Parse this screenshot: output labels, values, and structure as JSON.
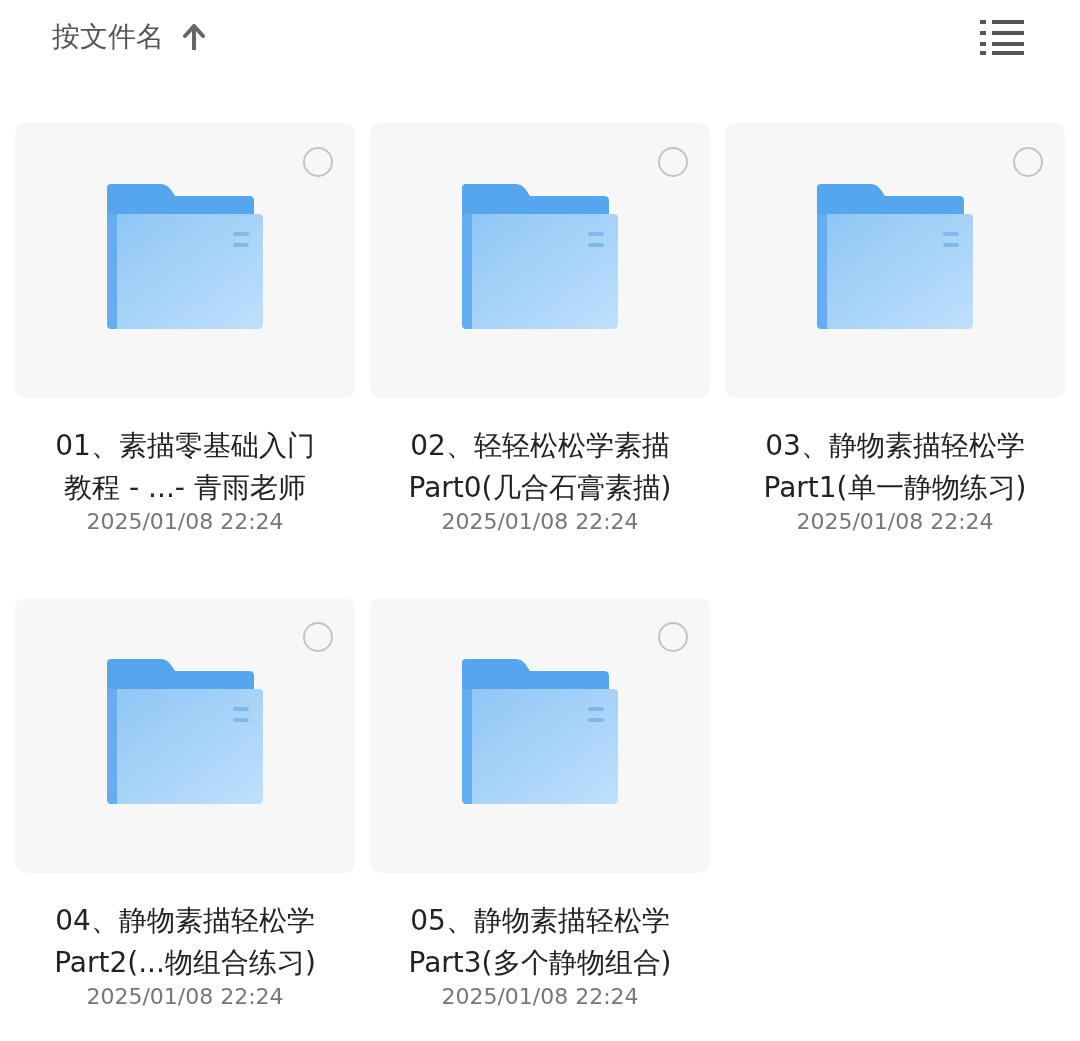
{
  "sort": {
    "label": "按文件名",
    "ascending": true
  },
  "folders": [
    {
      "title_lines": [
        "01、素描零基础入门",
        "教程 - ...- 青雨老师"
      ],
      "date": "2025/01/08 22:24",
      "selected": false
    },
    {
      "title_lines": [
        "02、轻轻松松学素描",
        "Part0(几合石膏素描)"
      ],
      "date": "2025/01/08 22:24",
      "selected": false
    },
    {
      "title_lines": [
        "03、静物素描轻松学",
        "Part1(单一静物练习)"
      ],
      "date": "2025/01/08 22:24",
      "selected": false
    },
    {
      "title_lines": [
        "04、静物素描轻松学",
        "Part2(...物组合练习)"
      ],
      "date": "2025/01/08 22:24",
      "selected": false
    },
    {
      "title_lines": [
        "05、静物素描轻松学",
        "Part3(多个静物组合)"
      ],
      "date": "2025/01/08 22:24",
      "selected": false
    }
  ]
}
